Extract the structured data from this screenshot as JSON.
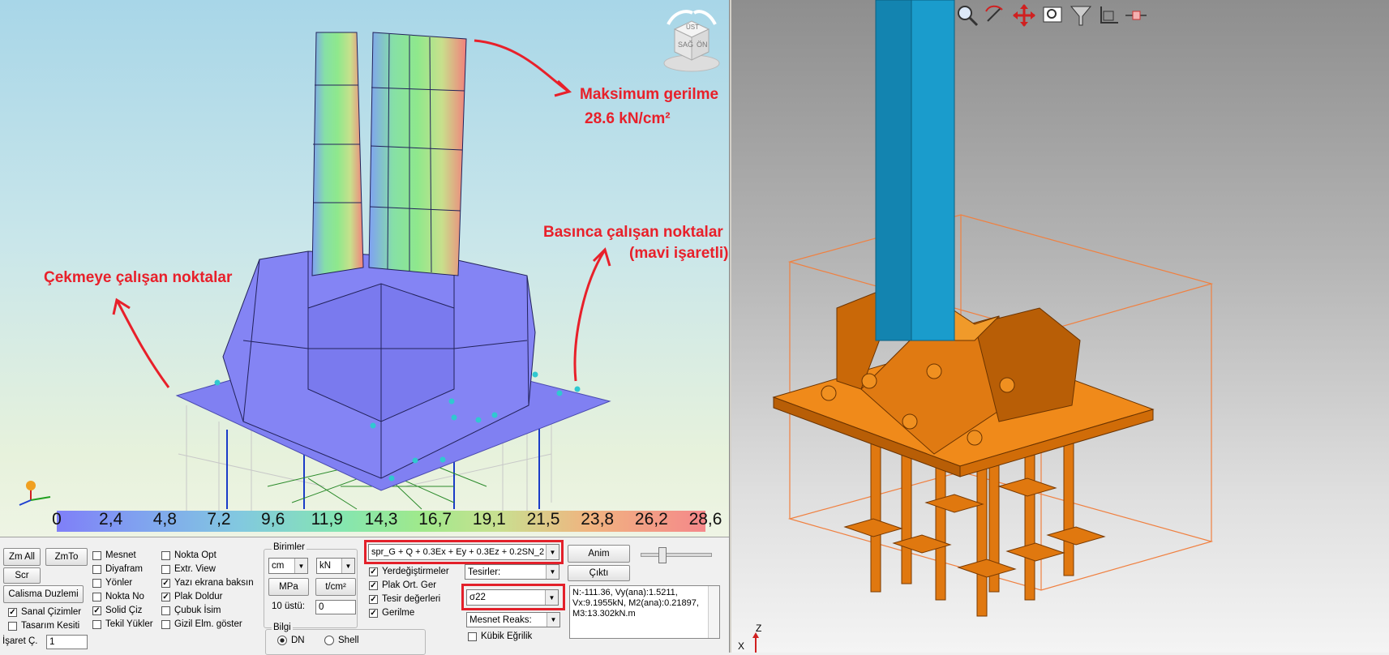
{
  "annotations": {
    "max_stress_title": "Maksimum gerilme",
    "max_stress_value": "28.6 kN/cm²",
    "compression_line1": "Basınca çalışan noktalar",
    "compression_line2": "(mavi işaretli)",
    "tension": "Çekmeye çalışan noktalar"
  },
  "viewcube": {
    "top": "ÜST",
    "left": "SAĞ",
    "front": "ÖN"
  },
  "legend": {
    "ticks": [
      "0",
      "2,4",
      "4,8",
      "7,2",
      "9,6",
      "11,9",
      "14,3",
      "16,7",
      "19,1",
      "21,5",
      "23,8",
      "26,2",
      "28,6"
    ]
  },
  "panel": {
    "buttons": {
      "zm_all": "Zm All",
      "zm_to": "ZmTo",
      "scr": "Scr",
      "calisma": "Calisma Duzlemi",
      "tf": "t/cm²",
      "mpa": "MPa",
      "anim": "Anim",
      "cikti": "Çıktı"
    },
    "checks_left": [
      {
        "label": "Sanal Çizimler",
        "checked": true
      },
      {
        "label": "Tasarım Kesiti",
        "checked": false
      }
    ],
    "checks_col2": [
      {
        "label": "Mesnet",
        "checked": false
      },
      {
        "label": "Diyafram",
        "checked": false
      },
      {
        "label": "Yönler",
        "checked": false
      },
      {
        "label": "Nokta No",
        "checked": false
      },
      {
        "label": "Solid Çiz",
        "checked": true
      },
      {
        "label": "Tekil Yükler",
        "checked": false
      }
    ],
    "checks_col3": [
      {
        "label": "Nokta Opt",
        "checked": false
      },
      {
        "label": "Extr. View",
        "checked": false
      },
      {
        "label": "Yazı ekrana baksın",
        "checked": true
      },
      {
        "label": "Plak Doldur",
        "checked": true
      },
      {
        "label": "Çubuk İsim",
        "checked": false
      },
      {
        "label": "Gizil Elm. göster",
        "checked": false
      }
    ],
    "isaret_label": "İşaret Ç.",
    "isaret_value": "1",
    "birimler_title": "Birimler",
    "unit_length": "cm",
    "unit_force": "kN",
    "ustu_label": "10 üstü:",
    "ustu_value": "0",
    "bilgi_title": "Bilgi",
    "radio_dn": "DN",
    "radio_shell": "Shell",
    "combo": "spr_G + Q + 0.3Ex + Ey + 0.3Ez + 0.2SN_2",
    "checks_col4": [
      {
        "label": "Yerdeğiştirmeler",
        "checked": true
      },
      {
        "label": "Plak Ort. Ger",
        "checked": true
      },
      {
        "label": "Tesir değerleri",
        "checked": true
      },
      {
        "label": "Gerilme",
        "checked": true
      }
    ],
    "tesirler": "Tesirler:",
    "sigma": "σ22",
    "mesnet_reaks": "Mesnet Reaks:",
    "kubik": "Kübik Eğrilik",
    "kubik_checked": false,
    "info_text": "N:-111.36, Vy(ana):1.5211, Vx:9.1955kN, M2(ana):0.21897, M3:13.302kN.m"
  },
  "axis_labels": {
    "z": "Z",
    "x": "X"
  },
  "colors": {
    "annotation": "#e8202a",
    "column": "#1a9ccc",
    "plate": "#e07810",
    "highlight": "#e3202a"
  }
}
